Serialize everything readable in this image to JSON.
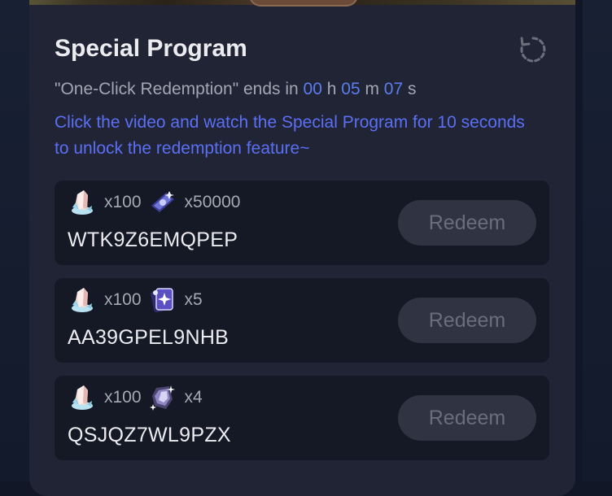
{
  "panel": {
    "title": "Special Program",
    "timer": {
      "prefix": "\"One-Click Redemption\" ends in ",
      "hours": "00",
      "h_label": " h ",
      "minutes": "05",
      "m_label": " m ",
      "seconds": "07",
      "s_label": " s"
    },
    "notice": "Click the video and watch the Special Program for 10 seconds to unlock the redemption feature~"
  },
  "codes": [
    {
      "rewards": [
        {
          "icon": "crystal-icon",
          "qty": "x100"
        },
        {
          "icon": "pass-ticket-icon",
          "qty": "x50000"
        }
      ],
      "code": "WTK9Z6EMQPEP",
      "button": "Redeem"
    },
    {
      "rewards": [
        {
          "icon": "crystal-icon",
          "qty": "x100"
        },
        {
          "icon": "card-pack-icon",
          "qty": "x5"
        }
      ],
      "code": "AA39GPEL9NHB",
      "button": "Redeem"
    },
    {
      "rewards": [
        {
          "icon": "crystal-icon",
          "qty": "x100"
        },
        {
          "icon": "shard-icon",
          "qty": "x4"
        }
      ],
      "code": "QSJQZ7WL9PZX",
      "button": "Redeem"
    }
  ],
  "colors": {
    "panel_bg": "#202434",
    "card_bg": "#151926",
    "accent": "#5b6ff5",
    "button_bg": "#2f3342",
    "button_text": "#6a6e7c"
  }
}
